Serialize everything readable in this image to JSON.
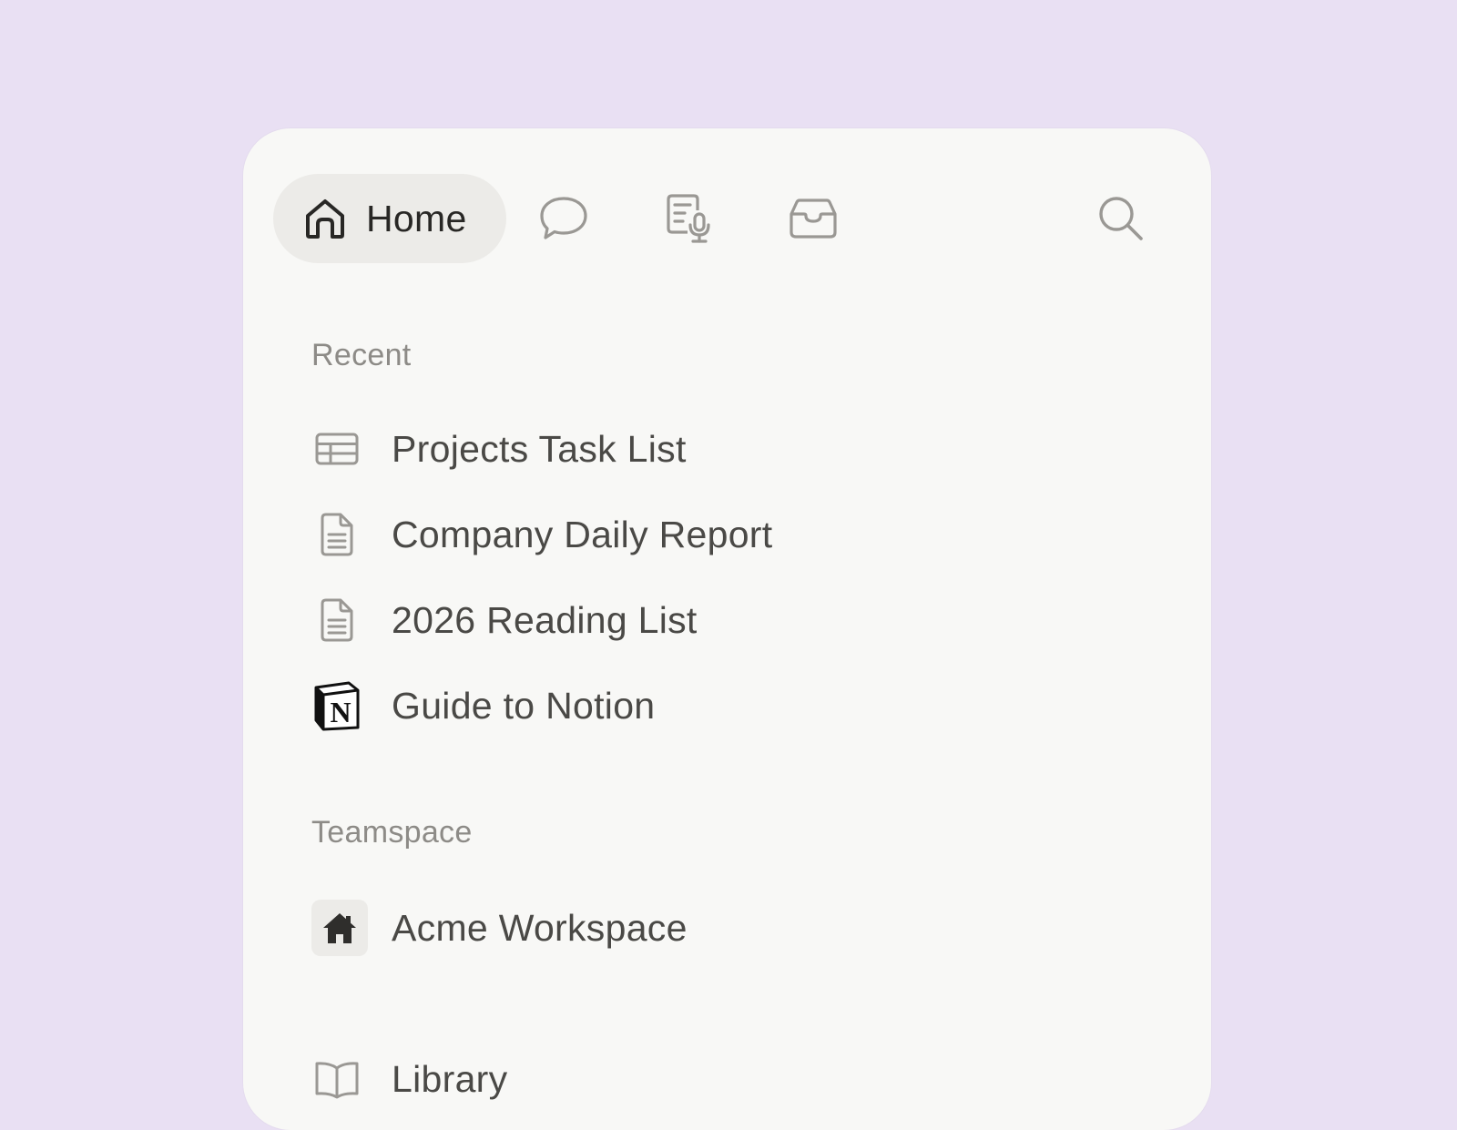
{
  "tabs": {
    "home_label": "Home",
    "home_icon": "home-icon",
    "chat_icon": "chat-bubble-icon",
    "meeting_notes_icon": "meeting-notes-icon",
    "inbox_icon": "inbox-icon",
    "search_icon": "search-icon"
  },
  "recent": {
    "label": "Recent",
    "items": [
      {
        "label": "Projects Task List",
        "icon": "table-icon"
      },
      {
        "label": "Company Daily Report",
        "icon": "page-icon"
      },
      {
        "label": "2026 Reading List",
        "icon": "page-icon"
      },
      {
        "label": "Guide to Notion",
        "icon": "notion-logo-icon"
      }
    ]
  },
  "teamspace": {
    "label": "Teamspace",
    "items": [
      {
        "label": "Acme Workspace",
        "icon": "house-icon"
      }
    ]
  },
  "library": {
    "label": "Library",
    "icon": "book-icon"
  },
  "colors": {
    "background": "#e9e0f3",
    "panel": "#f8f8f6",
    "active_tab": "#ecebe8",
    "text_primary": "#282725",
    "text_secondary": "#4a4946",
    "section_label": "#8d8b87",
    "icon": "#9a9894"
  }
}
